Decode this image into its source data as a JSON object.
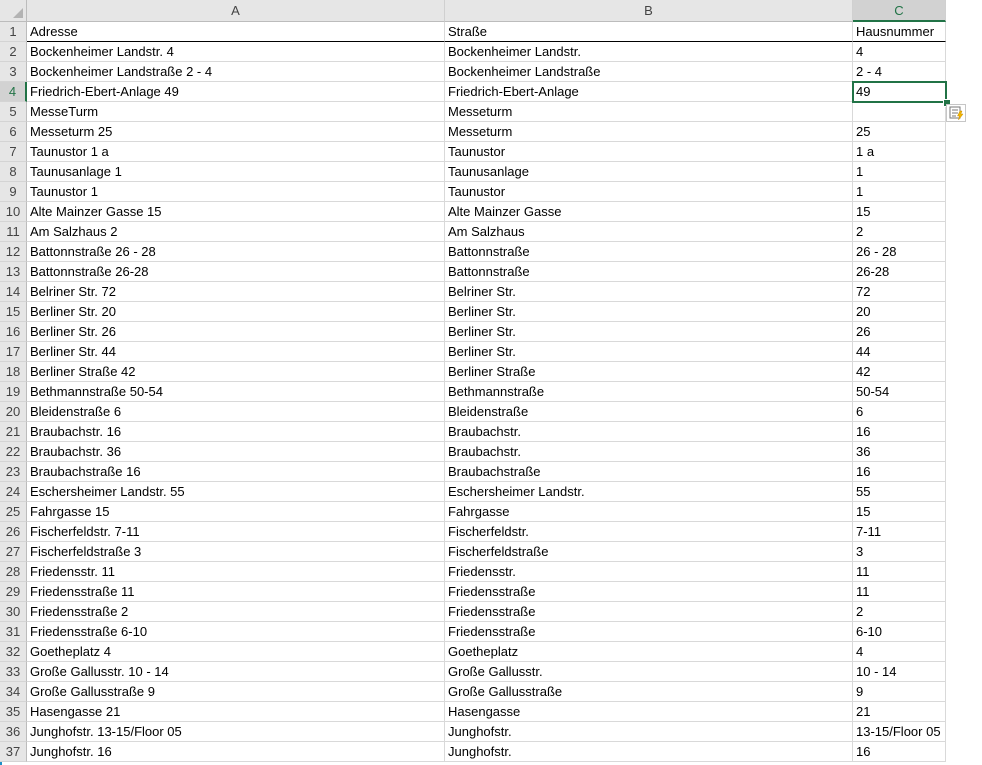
{
  "columns": [
    "A",
    "B",
    "C"
  ],
  "active_column": "C",
  "active_row": "4",
  "colors": {
    "accent": "#217346",
    "grid": "#d9d9d9",
    "header_bg": "#e6e6e6",
    "left_bar": "#1e90c8"
  },
  "icons": {
    "corner": "select-all-triangle-icon",
    "flash_fill": "flash-fill-options-icon"
  },
  "rows": [
    {
      "n": "1",
      "a": "Adresse",
      "b": "Straße",
      "c": "Hausnummer"
    },
    {
      "n": "2",
      "a": "Bockenheimer Landstr. 4",
      "b": "Bockenheimer Landstr.",
      "c": "4"
    },
    {
      "n": "3",
      "a": "Bockenheimer Landstraße 2 - 4",
      "b": "Bockenheimer Landstraße",
      "c": "2 - 4"
    },
    {
      "n": "4",
      "a": "Friedrich-Ebert-Anlage 49",
      "b": "Friedrich-Ebert-Anlage",
      "c": "49"
    },
    {
      "n": "5",
      "a": "MesseTurm",
      "b": "Messeturm",
      "c": ""
    },
    {
      "n": "6",
      "a": "Messeturm 25",
      "b": "Messeturm",
      "c": "25"
    },
    {
      "n": "7",
      "a": "Taunustor  1 a",
      "b": "Taunustor",
      "c": "1 a"
    },
    {
      "n": "8",
      "a": "Taunusanlage 1",
      "b": "Taunusanlage",
      "c": "1"
    },
    {
      "n": "9",
      "a": "Taunustor 1",
      "b": "Taunustor",
      "c": "1"
    },
    {
      "n": "10",
      "a": "Alte Mainzer Gasse 15",
      "b": "Alte Mainzer Gasse",
      "c": "15"
    },
    {
      "n": "11",
      "a": "Am Salzhaus 2",
      "b": "Am Salzhaus",
      "c": "2"
    },
    {
      "n": "12",
      "a": "Battonnstraße 26 - 28",
      "b": "Battonnstraße",
      "c": "26 - 28"
    },
    {
      "n": "13",
      "a": "Battonnstraße 26-28",
      "b": "Battonnstraße",
      "c": "26-28"
    },
    {
      "n": "14",
      "a": "Belriner Str. 72",
      "b": "Belriner Str.",
      "c": "72"
    },
    {
      "n": "15",
      "a": "Berliner Str. 20",
      "b": "Berliner Str.",
      "c": "20"
    },
    {
      "n": "16",
      "a": "Berliner Str. 26",
      "b": "Berliner Str.",
      "c": "26"
    },
    {
      "n": "17",
      "a": "Berliner Str. 44",
      "b": "Berliner Str.",
      "c": "44"
    },
    {
      "n": "18",
      "a": "Berliner Straße 42",
      "b": "Berliner Straße",
      "c": "42"
    },
    {
      "n": "19",
      "a": "Bethmannstraße 50-54",
      "b": "Bethmannstraße",
      "c": "50-54"
    },
    {
      "n": "20",
      "a": "Bleidenstraße 6",
      "b": "Bleidenstraße",
      "c": "6"
    },
    {
      "n": "21",
      "a": "Braubachstr. 16",
      "b": "Braubachstr.",
      "c": "16"
    },
    {
      "n": "22",
      "a": "Braubachstr. 36",
      "b": "Braubachstr.",
      "c": "36"
    },
    {
      "n": "23",
      "a": "Braubachstraße 16",
      "b": "Braubachstraße",
      "c": "16"
    },
    {
      "n": "24",
      "a": "Eschersheimer Landstr. 55",
      "b": "Eschersheimer Landstr.",
      "c": "55"
    },
    {
      "n": "25",
      "a": "Fahrgasse 15",
      "b": "Fahrgasse",
      "c": "15"
    },
    {
      "n": "26",
      "a": "Fischerfeldstr. 7-11",
      "b": "Fischerfeldstr.",
      "c": "7-11"
    },
    {
      "n": "27",
      "a": "Fischerfeldstraße 3",
      "b": "Fischerfeldstraße",
      "c": "3"
    },
    {
      "n": "28",
      "a": "Friedensstr. 11",
      "b": "Friedensstr.",
      "c": "11"
    },
    {
      "n": "29",
      "a": "Friedensstraße 11",
      "b": "Friedensstraße",
      "c": "11"
    },
    {
      "n": "30",
      "a": "Friedensstraße 2",
      "b": "Friedensstraße",
      "c": "2"
    },
    {
      "n": "31",
      "a": "Friedensstraße 6-10",
      "b": "Friedensstraße",
      "c": "6-10"
    },
    {
      "n": "32",
      "a": "Goetheplatz 4",
      "b": "Goetheplatz",
      "c": "4"
    },
    {
      "n": "33",
      "a": "Große Gallusstr. 10 - 14",
      "b": "Große Gallusstr.",
      "c": "10 - 14"
    },
    {
      "n": "34",
      "a": "Große Gallusstraße 9",
      "b": "Große Gallusstraße",
      "c": "9"
    },
    {
      "n": "35",
      "a": "Hasengasse 21",
      "b": "Hasengasse",
      "c": "21"
    },
    {
      "n": "36",
      "a": "Junghofstr. 13-15/Floor 05",
      "b": "Junghofstr.",
      "c": "13-15/Floor 05"
    },
    {
      "n": "37",
      "a": "Junghofstr. 16",
      "b": "Junghofstr.",
      "c": "16"
    }
  ]
}
